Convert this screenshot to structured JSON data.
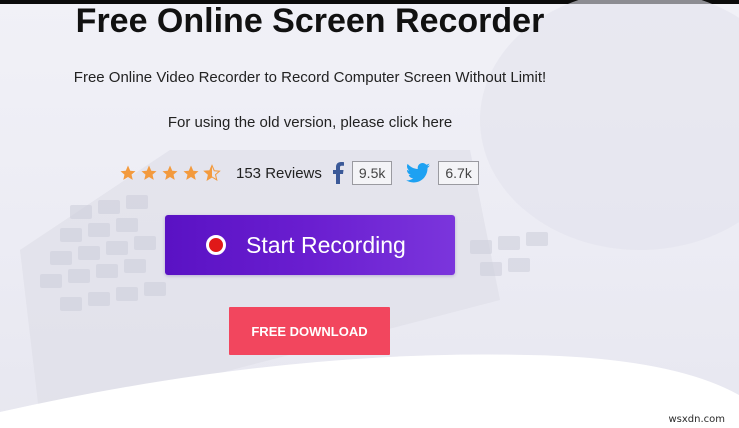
{
  "header": {
    "title": "Free Online Screen Recorder",
    "subtitle": "Free Online Video Recorder to Record Computer Screen Without Limit!",
    "old_version_link": "For using the old version, please click here"
  },
  "rating": {
    "stars": 4.5,
    "max_stars": 5,
    "star_color": "#f39a3d",
    "reviews_text": "153 Reviews"
  },
  "social": {
    "facebook": {
      "count": "9.5k",
      "color": "#3b5998",
      "icon": "facebook-icon"
    },
    "twitter": {
      "count": "6.7k",
      "color": "#1da1f2",
      "icon": "twitter-icon"
    }
  },
  "actions": {
    "start_recording_label": "Start Recording",
    "record_button_color": "#6a1ed0",
    "free_download_label": "FREE DOWNLOAD",
    "download_button_color": "#f2465e"
  },
  "watermark": "wsxdn.com"
}
